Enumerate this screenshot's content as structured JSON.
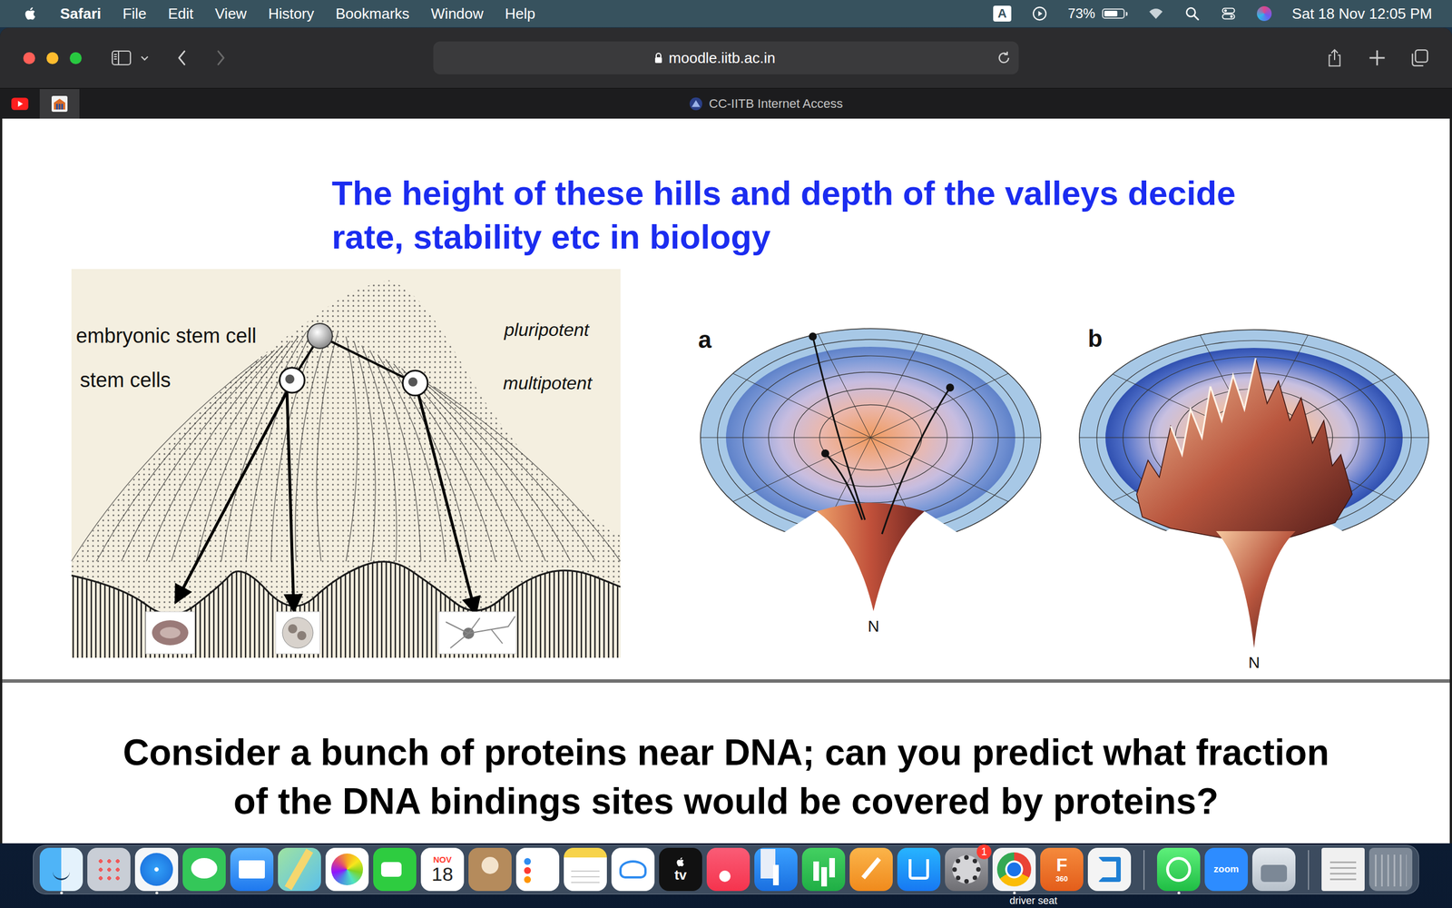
{
  "menubar": {
    "app": "Safari",
    "menus": [
      "File",
      "Edit",
      "View",
      "History",
      "Bookmarks",
      "Window",
      "Help"
    ],
    "input_source": "A",
    "battery": {
      "reading": "73%",
      "level": 0.73
    },
    "clock": "Sat 18 Nov 12:05 PM"
  },
  "browser": {
    "address": "moodle.iitb.ac.in",
    "back_enabled": true,
    "forward_enabled": false,
    "pinned_tabs": [
      {
        "kind": "youtube",
        "selected": false
      },
      {
        "kind": "iitb",
        "selected": true
      }
    ],
    "tab_title": "CC-IITB Internet Access"
  },
  "slide": {
    "heading": "The height of these hills and depth of the valleys decide rate, stability etc in biology",
    "landscape": {
      "labels": [
        {
          "text": "embryonic stem cell",
          "kind": "cell"
        },
        {
          "text": "stem cells",
          "kind": "cell"
        },
        {
          "text": "pluripotent",
          "kind": "potency"
        },
        {
          "text": "multipotent",
          "kind": "potency"
        }
      ]
    },
    "funnels": [
      {
        "label": "a",
        "bottom": "N",
        "kind": "smooth"
      },
      {
        "label": "b",
        "bottom": "N",
        "kind": "rugged"
      }
    ]
  },
  "next_slide": {
    "question": "Consider a bunch of proteins near DNA; can you predict what fraction of the DNA bindings sites would be covered by proteins?"
  },
  "dock": {
    "groups": [
      [
        {
          "kind": "finder",
          "running": true
        },
        {
          "kind": "launchpad",
          "running": false
        },
        {
          "kind": "safari",
          "running": true
        },
        {
          "kind": "messages",
          "running": false
        },
        {
          "kind": "mail",
          "running": false
        },
        {
          "kind": "maps",
          "running": false
        },
        {
          "kind": "photos",
          "running": false
        },
        {
          "kind": "facetime",
          "running": false
        },
        {
          "kind": "calendar",
          "running": false,
          "month": "NOV",
          "day": "18"
        },
        {
          "kind": "contacts",
          "running": false
        },
        {
          "kind": "reminders",
          "running": false
        },
        {
          "kind": "notes",
          "running": false
        },
        {
          "kind": "freeform",
          "running": false
        },
        {
          "kind": "tv",
          "running": false,
          "text": "tv"
        },
        {
          "kind": "music",
          "running": false
        },
        {
          "kind": "keynote",
          "running": false
        },
        {
          "kind": "numbers",
          "running": false
        },
        {
          "kind": "pages",
          "running": false
        },
        {
          "kind": "appstore",
          "running": false
        },
        {
          "kind": "settings",
          "running": false,
          "badge": "1"
        },
        {
          "kind": "chrome",
          "running": true
        },
        {
          "kind": "fusion",
          "running": false,
          "text": "F",
          "subtext": "360"
        },
        {
          "kind": "vscode",
          "running": false
        }
      ],
      [
        {
          "kind": "whatsapp",
          "running": true
        },
        {
          "kind": "zoom",
          "running": false,
          "text": "zoom"
        },
        {
          "kind": "preview",
          "running": false
        }
      ],
      [
        {
          "kind": "document",
          "running": false
        },
        {
          "kind": "trash",
          "running": false
        }
      ]
    ]
  },
  "desktop": {
    "label": "driver seat"
  }
}
